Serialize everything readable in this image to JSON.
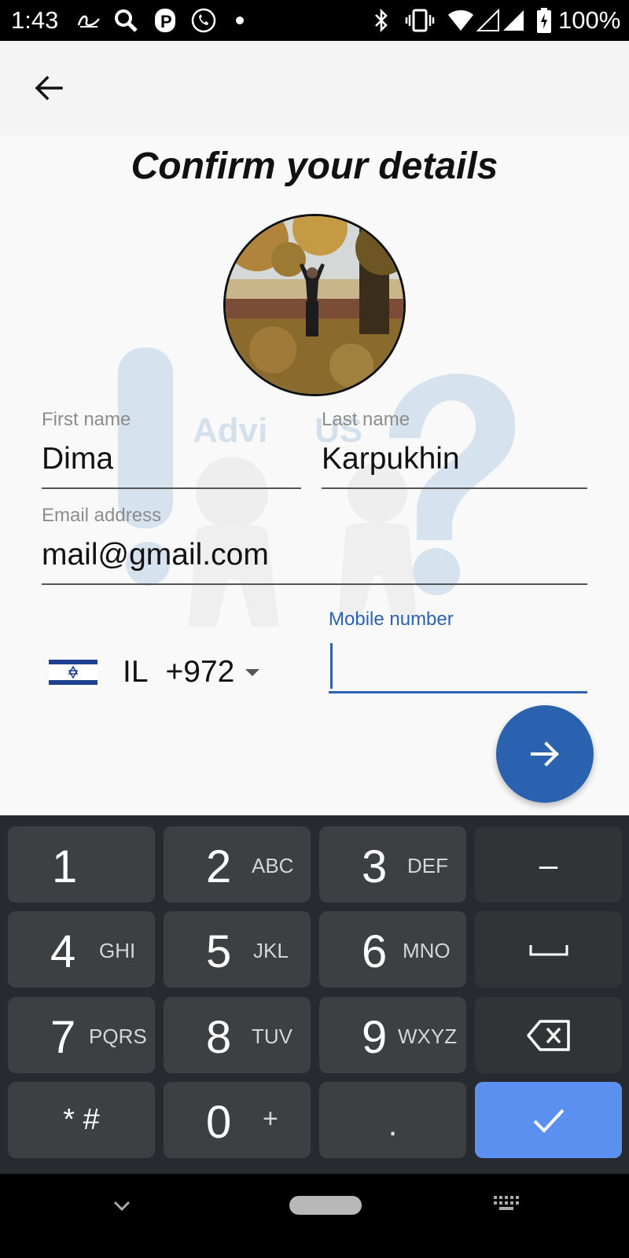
{
  "status_bar": {
    "time": "1:43",
    "battery": "100%",
    "icons_left": [
      "alibaba-icon",
      "search-icon",
      "parking-icon",
      "phone-icon",
      "dot-icon"
    ],
    "icons_right": [
      "bluetooth-icon",
      "vibrate-icon",
      "wifi-icon",
      "signal-icon",
      "battery-icon"
    ]
  },
  "header": {
    "back_icon": "arrow-left-icon"
  },
  "page": {
    "title": "Confirm your details"
  },
  "form": {
    "first_name": {
      "label": "First name",
      "value": "Dima"
    },
    "last_name": {
      "label": "Last name",
      "value": "Karpukhin"
    },
    "email": {
      "label": "Email address",
      "value": "mail@gmail.com"
    },
    "country": {
      "code": "IL",
      "dial": "+972",
      "flag": "israel-flag-icon"
    },
    "mobile": {
      "label": "Mobile number",
      "value": ""
    }
  },
  "fab": {
    "icon": "arrow-right-icon"
  },
  "keyboard": {
    "keys": [
      {
        "digit": "1",
        "letters": ""
      },
      {
        "digit": "2",
        "letters": "ABC"
      },
      {
        "digit": "3",
        "letters": "DEF"
      },
      {
        "symbol": "–"
      },
      {
        "digit": "4",
        "letters": "GHI"
      },
      {
        "digit": "5",
        "letters": "JKL"
      },
      {
        "digit": "6",
        "letters": "MNO"
      },
      {
        "symbol": "space-icon"
      },
      {
        "digit": "7",
        "letters": "PQRS"
      },
      {
        "digit": "8",
        "letters": "TUV"
      },
      {
        "digit": "9",
        "letters": "WXYZ"
      },
      {
        "symbol": "backspace-icon"
      },
      {
        "symbol": "* #"
      },
      {
        "digit": "0",
        "letters": "+"
      },
      {
        "symbol": "."
      },
      {
        "symbol": "check-icon"
      }
    ]
  },
  "colors": {
    "accent": "#2a62b0",
    "keyboard_bg": "#272a2e",
    "key_bg": "#3c4043",
    "done_key": "#5b8ff0"
  }
}
